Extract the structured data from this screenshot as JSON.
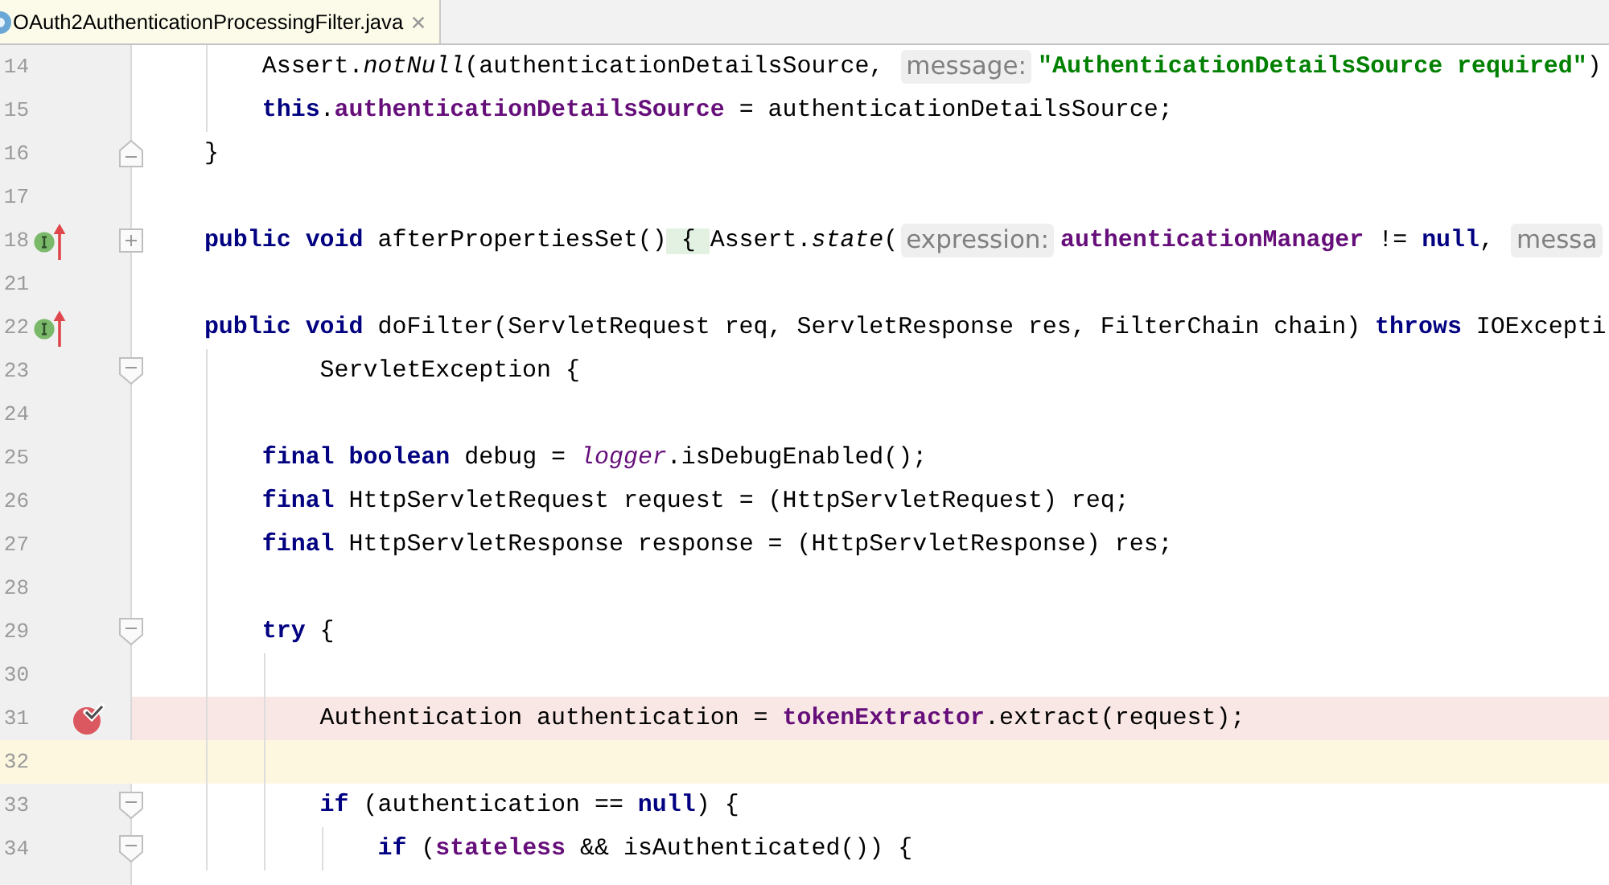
{
  "tabs": [
    {
      "title": "OAuth2AuthenticationProcessingFilter.java",
      "selected": true
    }
  ],
  "editor": {
    "lines": [
      {
        "number": "14",
        "current": false,
        "segments": [
          {
            "kind": "code",
            "parts": [
              {
                "kind": "plain",
                "text": "        Assert."
              },
              {
                "kind": "static-method",
                "text": "notNull"
              },
              {
                "kind": "plain",
                "text": "(authenticationDetailsSource, "
              }
            ]
          },
          {
            "kind": "hint",
            "text": "message:"
          },
          {
            "kind": "code",
            "parts": [
              {
                "kind": "string",
                "text": "\"AuthenticationDetailsSource required\""
              },
              {
                "kind": "plain",
                "text": ")"
              }
            ]
          }
        ]
      },
      {
        "number": "15",
        "current": false,
        "segments": [
          {
            "kind": "code",
            "parts": [
              {
                "kind": "keyword",
                "text": "        this"
              },
              {
                "kind": "plain",
                "text": "."
              },
              {
                "kind": "field",
                "text": "authenticationDetailsSource"
              },
              {
                "kind": "plain",
                "text": " = authenticationDetailsSource;"
              }
            ]
          }
        ]
      },
      {
        "number": "16",
        "current": false,
        "fold_marker": {
          "kind": "end"
        },
        "segments": [
          {
            "kind": "code",
            "parts": [
              {
                "kind": "plain",
                "text": "    }"
              }
            ]
          }
        ]
      },
      {
        "number": "17",
        "current": false
      },
      {
        "number": "18",
        "current": false,
        "gutter_icon": {
          "kind": "implements"
        },
        "fold_marker": {
          "kind": "collapsed"
        },
        "segments": [
          {
            "kind": "code",
            "parts": [
              {
                "kind": "keyword",
                "text": "    public void"
              },
              {
                "kind": "plain",
                "text": " afterPropertiesSet()"
              },
              {
                "kind": "fold-brace",
                "text": " { "
              },
              {
                "kind": "plain",
                "text": "Assert."
              },
              {
                "kind": "static-method",
                "text": "state"
              },
              {
                "kind": "plain",
                "text": "("
              }
            ]
          },
          {
            "kind": "hint",
            "text": "expression:"
          },
          {
            "kind": "code",
            "parts": [
              {
                "kind": "field",
                "text": "authenticationManager"
              },
              {
                "kind": "plain",
                "text": " != "
              },
              {
                "kind": "keyword",
                "text": "null"
              },
              {
                "kind": "plain",
                "text": ", "
              }
            ]
          },
          {
            "kind": "hint",
            "text": "messa"
          }
        ]
      },
      {
        "number": "21",
        "current": false
      },
      {
        "number": "22",
        "current": false,
        "gutter_icon": {
          "kind": "implements"
        },
        "segments": [
          {
            "kind": "code",
            "parts": [
              {
                "kind": "keyword",
                "text": "    public void"
              },
              {
                "kind": "plain",
                "text": " doFilter(ServletRequest req, ServletResponse res, FilterChain chain) "
              },
              {
                "kind": "keyword",
                "text": "throws"
              },
              {
                "kind": "plain",
                "text": " IOExcepti"
              }
            ]
          }
        ]
      },
      {
        "number": "23",
        "current": false,
        "fold_marker": {
          "kind": "start"
        },
        "segments": [
          {
            "kind": "code",
            "parts": [
              {
                "kind": "plain",
                "text": "            ServletException {"
              }
            ]
          }
        ]
      },
      {
        "number": "24",
        "current": false
      },
      {
        "number": "25",
        "current": false,
        "segments": [
          {
            "kind": "code",
            "parts": [
              {
                "kind": "keyword",
                "text": "        final boolean"
              },
              {
                "kind": "plain",
                "text": " debug = "
              },
              {
                "kind": "static-field",
                "text": "logger"
              },
              {
                "kind": "plain",
                "text": ".isDebugEnabled();"
              }
            ]
          }
        ]
      },
      {
        "number": "26",
        "current": false,
        "segments": [
          {
            "kind": "code",
            "parts": [
              {
                "kind": "keyword",
                "text": "        final"
              },
              {
                "kind": "plain",
                "text": " HttpServletRequest request = (HttpServletRequest) req;"
              }
            ]
          }
        ]
      },
      {
        "number": "27",
        "current": false,
        "segments": [
          {
            "kind": "code",
            "parts": [
              {
                "kind": "keyword",
                "text": "        final"
              },
              {
                "kind": "plain",
                "text": " HttpServletResponse response = (HttpServletResponse) res;"
              }
            ]
          }
        ]
      },
      {
        "number": "28",
        "current": false
      },
      {
        "number": "29",
        "current": false,
        "fold_marker": {
          "kind": "start"
        },
        "segments": [
          {
            "kind": "code",
            "parts": [
              {
                "kind": "keyword",
                "text": "        try"
              },
              {
                "kind": "plain",
                "text": " {"
              }
            ]
          }
        ]
      },
      {
        "number": "30",
        "current": false
      },
      {
        "number": "31",
        "current": false,
        "gutter_icon": {
          "kind": "breakpoint"
        },
        "segments": [
          {
            "kind": "code",
            "parts": [
              {
                "kind": "plain",
                "text": "            Authentication authentication = "
              },
              {
                "kind": "field",
                "text": "tokenExtractor"
              },
              {
                "kind": "plain",
                "text": ".extract(request);"
              }
            ]
          }
        ]
      },
      {
        "number": "32",
        "current": true
      },
      {
        "number": "33",
        "current": false,
        "fold_marker": {
          "kind": "start"
        },
        "segments": [
          {
            "kind": "code",
            "parts": [
              {
                "kind": "keyword",
                "text": "            if"
              },
              {
                "kind": "plain",
                "text": " (authentication == "
              },
              {
                "kind": "keyword",
                "text": "null"
              },
              {
                "kind": "plain",
                "text": ") {"
              }
            ]
          }
        ]
      },
      {
        "number": "34",
        "current": false,
        "fold_marker": {
          "kind": "start"
        },
        "segments": [
          {
            "kind": "code",
            "parts": [
              {
                "kind": "keyword",
                "text": "                if"
              },
              {
                "kind": "plain",
                "text": " ("
              },
              {
                "kind": "field",
                "text": "stateless"
              },
              {
                "kind": "plain",
                "text": " && isAuthenticated()) {"
              }
            ]
          }
        ]
      }
    ]
  }
}
